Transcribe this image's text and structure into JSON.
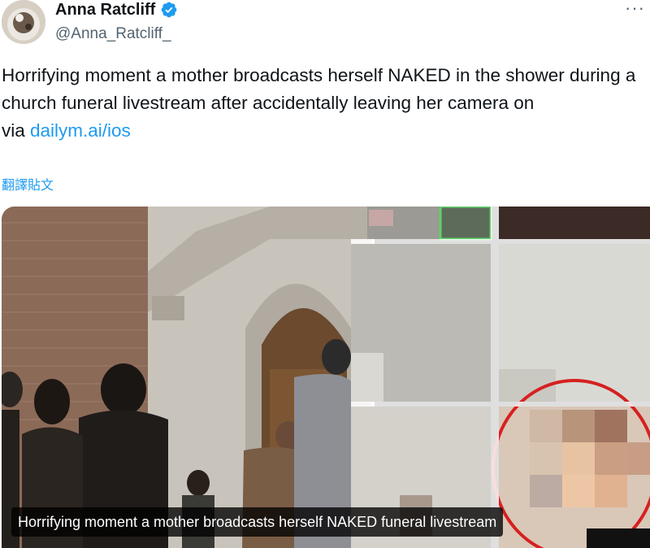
{
  "author": {
    "display_name": "Anna Ratcliff",
    "handle": "@Anna_Ratcliff_",
    "verified": true,
    "verified_icon": "verified-badge-icon",
    "avatar_icon": "avatar"
  },
  "menu": {
    "more_label": "···"
  },
  "tweet": {
    "text_line": "Horrifying moment a mother broadcasts herself NAKED in the shower during a church funeral livestream after accidentally leaving her camera on",
    "via_prefix": "via ",
    "link_text": "dailym.ai/ios",
    "translate_label": "翻譯貼文"
  },
  "media": {
    "caption": "Horrifying moment a mother broadcasts herself NAKED funeral livestream"
  },
  "colors": {
    "link": "#1d9bf0",
    "secondary_text": "#536471",
    "highlight_circle": "#d62020"
  }
}
